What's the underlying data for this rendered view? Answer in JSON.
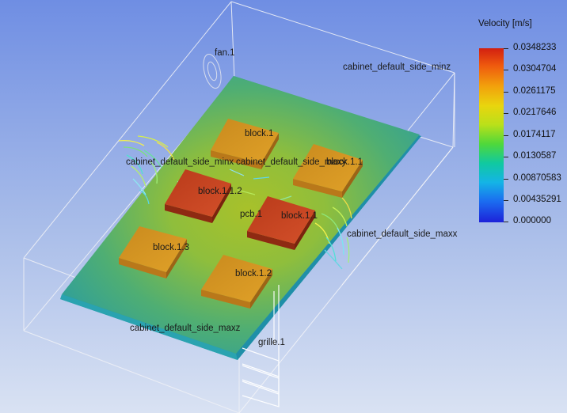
{
  "legend": {
    "title": "Velocity [m/s]",
    "ticks": [
      "0.0348233",
      "0.0304704",
      "0.0261175",
      "0.0217646",
      "0.0174117",
      "0.0130587",
      "0.00870583",
      "0.00435291",
      "0.000000"
    ]
  },
  "labels": {
    "fan": "fan.1",
    "side_minz": "cabinet_default_side_minz",
    "side_minx": "cabinet_default_side_minx",
    "side_maxy": "cabinet_default_side_maxy",
    "side_maxx": "cabinet_default_side_maxx",
    "side_maxz": "cabinet_default_side_maxz",
    "grille": "grille.1",
    "block_1": "block.1",
    "block_1_1": "block.1.1",
    "block_1_2": "block.1.2",
    "block_1_3": "block.1.3",
    "block_1_1_2": "block.1.1.2",
    "block_1_1_1": "block.1.1",
    "pcb": "pcb.1"
  },
  "colors": {
    "background_top": "#6f8ee3",
    "background_bottom": "#d9e2f3",
    "board_plane": "#4aa888",
    "block_hot": "#c9481e",
    "block_warm": "#d9951c",
    "wireframe": "#e8e8e8"
  }
}
